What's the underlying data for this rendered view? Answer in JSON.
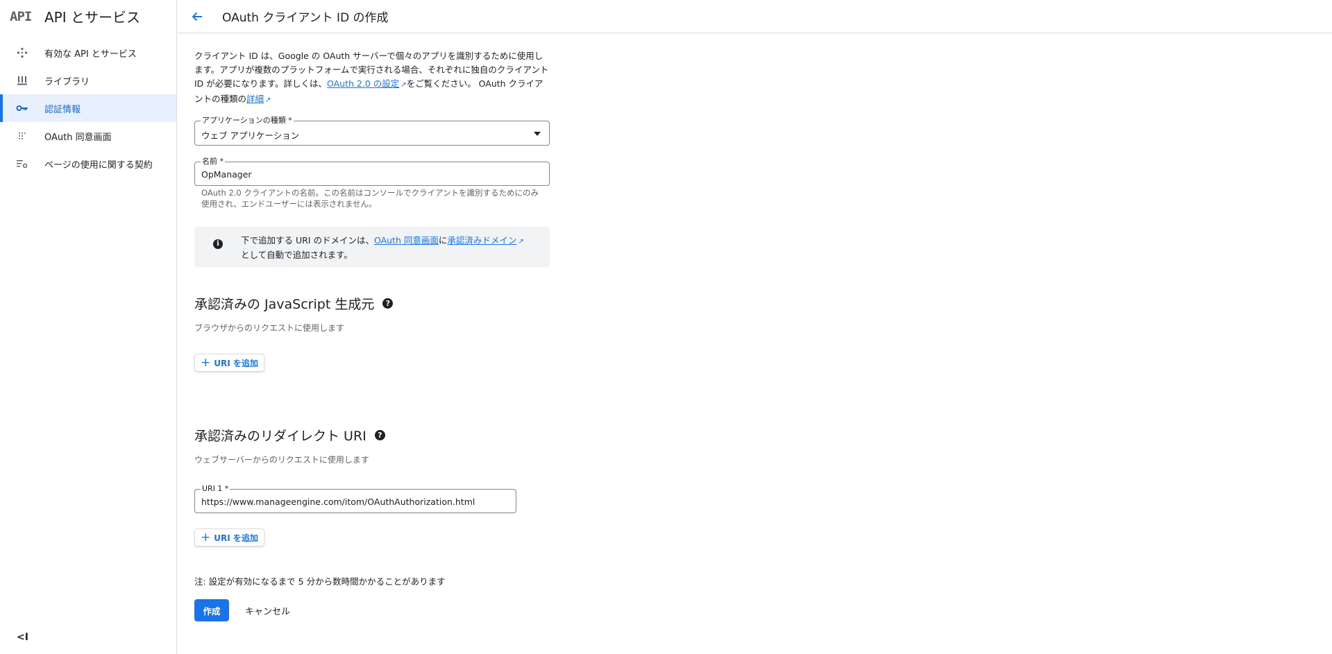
{
  "sidebar": {
    "logo": "API",
    "title": "API とサービス",
    "items": [
      {
        "label": "有効な API とサービス",
        "icon": "api-diamond-icon"
      },
      {
        "label": "ライブラリ",
        "icon": "library-icon"
      },
      {
        "label": "認証情報",
        "icon": "key-icon",
        "active": true
      },
      {
        "label": "OAuth 同意画面",
        "icon": "dots-grid-icon"
      },
      {
        "label": "ページの使用に関する契約",
        "icon": "settings-list-icon"
      }
    ],
    "collapse_label": "<I"
  },
  "header": {
    "back_icon": "arrow-back-icon",
    "title": "OAuth クライアント ID の作成"
  },
  "intro": {
    "text1": "クライアント ID は、Google の OAuth サーバーで個々のアプリを識別するために使用します。アプリが複数のプラットフォームで実行される場合、それぞれに独自のクライアント ID が必要になります。詳しくは、",
    "link1": "OAuth 2.0 の設定",
    "text2": "をご覧ください。 OAuth クライアントの種類の",
    "link2": "詳細"
  },
  "form": {
    "app_type": {
      "label": "アプリケーションの種類 *",
      "value": "ウェブ アプリケーション"
    },
    "name": {
      "label": "名前 *",
      "value": "OpManager"
    },
    "name_hint": "OAuth 2.0 クライアントの名前。この名前はコンソールでクライアントを識別するためにのみ使用され、エンドユーザーには表示されません。"
  },
  "info": {
    "text1": "下で追加する URI のドメインは、",
    "link1": "OAuth 同意画面",
    "text2": "に",
    "link2": "承認済みドメイン",
    "text3": "として自動で追加されます。"
  },
  "js_origins": {
    "title": "承認済みの JavaScript 生成元",
    "subtitle": "ブラウザからのリクエストに使用します",
    "add_label": "URI を追加"
  },
  "redirect_uris": {
    "title": "承認済みのリダイレクト URI",
    "subtitle": "ウェブサーバーからのリクエストに使用します",
    "uri1_label": "URI 1 *",
    "uri1_value": "https://www.manageengine.com/itom/OAuthAuthorization.html",
    "add_label": "URI を追加"
  },
  "footer": {
    "note": "注: 設定が有効になるまで 5 分から数時間かかることがあります",
    "create_label": "作成",
    "cancel_label": "キャンセル"
  },
  "colors": {
    "accent": "#1a73e8",
    "active_bg": "#e8f0fe",
    "info_bg": "#f1f3f4"
  }
}
